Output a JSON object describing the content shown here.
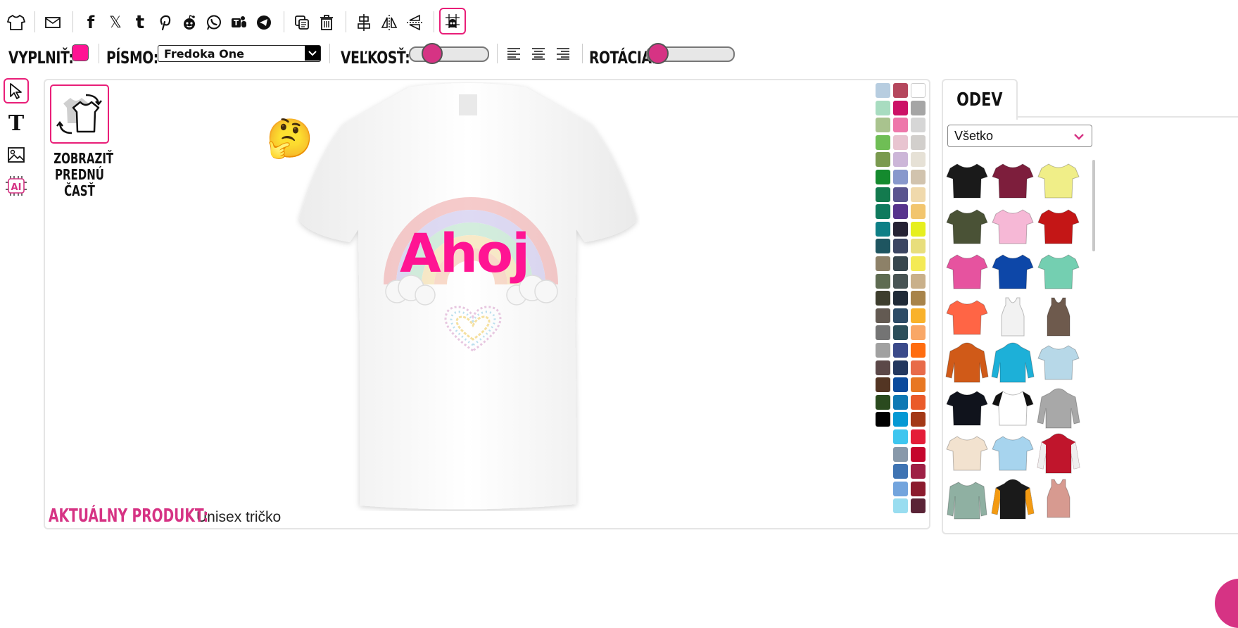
{
  "toolbar": {
    "icons": [
      "tshirt-icon",
      "mail-icon",
      "facebook-icon",
      "x-icon",
      "tumblr-icon",
      "pinterest-icon",
      "reddit-icon",
      "whatsapp-icon",
      "teams-icon",
      "telegram-icon",
      "duplicate-icon",
      "trash-icon",
      "align-center-icon",
      "flip-horizontal-icon",
      "flip-vertical-icon",
      "grid-snap-icon"
    ],
    "glyphs": {
      "facebook": "f",
      "x": "𝕏",
      "tumblr": "t"
    }
  },
  "props": {
    "fill_label": "VYPLNIŤ:",
    "fill_color": "#ff1493",
    "font_label": "PÍSMO:",
    "font_value": "Fredoka One",
    "size_label": "VEĽKOSŤ:",
    "size_level": 0.2,
    "rotation_label": "ROTÁCIA:",
    "rotation_level": 0.0
  },
  "tools": [
    "select-tool",
    "text-tool",
    "image-tool",
    "ai-tool"
  ],
  "text_tool_glyph": "T",
  "view_toggle": {
    "label_lines": [
      "ZOBRAZIŤ",
      "PREDNÚ",
      "ČASŤ"
    ]
  },
  "design": {
    "text": "Ahoj",
    "text_color": "#ff1493",
    "emoji": "🤔"
  },
  "current_product": {
    "label": "AKTUÁLNY PRODUKT:",
    "value": "Unisex tričko"
  },
  "palette": {
    "col1": [
      "#b7cde0",
      "#a8dcc0",
      "#a9c38e",
      "#6fbe55",
      "#7a9a4f",
      "#148a2e",
      "#137a4e",
      "#0f7a5e",
      "#0e7f86",
      "#1e5560",
      "#8d8168",
      "#5e6b51",
      "#3d3d2d",
      "#635a52",
      "#747474",
      "#a1a1a1",
      "#5b4848",
      "#533523",
      "#2a4a1e",
      "#000000"
    ],
    "col2": [
      "#b5475d",
      "#cc1166",
      "#ee77aa",
      "#e8c4d0",
      "#ccb6d8",
      "#8898cc",
      "#5a558f",
      "#57348d",
      "#252234",
      "#3b4562",
      "#37464e",
      "#485454",
      "#1f2a37",
      "#2c4b66",
      "#2b4e5a",
      "#3b4a8a",
      "#22375f",
      "#0b4a9c",
      "#0e78b4",
      "#0699d4",
      "#3ec6ef",
      "#8899aa",
      "#3f74b3",
      "#72a4dd",
      "#99ddf0"
    ],
    "col3": [
      "#ffffff",
      "#a5a5a5",
      "#d6d6d6",
      "#d2cfcc",
      "#e6e1d6",
      "#d1c3ae",
      "#f0d9ac",
      "#f2c56e",
      "#e6ef1e",
      "#e8de7c",
      "#f4ea55",
      "#c9b08a",
      "#a8844a",
      "#f9b22a",
      "#f9a766",
      "#ff6c0f",
      "#e86b49",
      "#e87722",
      "#ea5a29",
      "#a33816",
      "#e41c38",
      "#c5052c",
      "#9e2045",
      "#8b1a2d",
      "#5a2336"
    ]
  },
  "apparel": {
    "tab_label": "ODEV",
    "filter_value": "Všetko",
    "items": [
      {
        "name": "black-tshirt",
        "color": "#1a1a1a",
        "type": "tee"
      },
      {
        "name": "burgundy-women-tshirt",
        "color": "#7d1e3c",
        "type": "tee"
      },
      {
        "name": "yellow-tshirt",
        "color": "#f0ee88",
        "type": "tee"
      },
      {
        "name": "olive-tshirt",
        "color": "#4a5236",
        "type": "tee"
      },
      {
        "name": "pink-women-tshirt",
        "color": "#f6b8d6",
        "type": "tee"
      },
      {
        "name": "red-tshirt",
        "color": "#c41616",
        "type": "tee"
      },
      {
        "name": "magenta-women-tshirt",
        "color": "#e6539f",
        "type": "tee"
      },
      {
        "name": "royal-blue-tshirt",
        "color": "#0d47a8",
        "type": "tee"
      },
      {
        "name": "mint-tshirt",
        "color": "#74cfb1",
        "type": "tee"
      },
      {
        "name": "coral-women-tshirt",
        "color": "#ff6545",
        "type": "tee"
      },
      {
        "name": "white-tank-top",
        "color": "#f2f2f2",
        "type": "tank"
      },
      {
        "name": "brown-tank-top",
        "color": "#6e5a4d",
        "type": "tank"
      },
      {
        "name": "orange-hoodie",
        "color": "#d05a18",
        "type": "hoodie"
      },
      {
        "name": "cyan-hoodie",
        "color": "#1db0d8",
        "type": "hoodie"
      },
      {
        "name": "tie-dye-tshirt",
        "color": "#b7d8e8",
        "type": "tee"
      },
      {
        "name": "black-premium-tshirt",
        "color": "#10131c",
        "type": "tee"
      },
      {
        "name": "raglan-tshirt",
        "color": "#ffffff",
        "type": "tee"
      },
      {
        "name": "grey-hoodie",
        "color": "#a8a8a8",
        "type": "hoodie"
      },
      {
        "name": "natural-tshirt",
        "color": "#f2e2cf",
        "type": "tee"
      },
      {
        "name": "sky-ombre-tshirt",
        "color": "#a7d4ee",
        "type": "tee"
      },
      {
        "name": "red-varsity-jacket",
        "color": "#c0152c",
        "type": "hoodie"
      },
      {
        "name": "sage-longsleeve",
        "color": "#8fb0a2",
        "type": "long"
      },
      {
        "name": "black-orange-hoodie",
        "color": "#1a1a1a",
        "type": "hoodie"
      },
      {
        "name": "dusty-rose-tank",
        "color": "#d79a90",
        "type": "tank"
      }
    ]
  }
}
